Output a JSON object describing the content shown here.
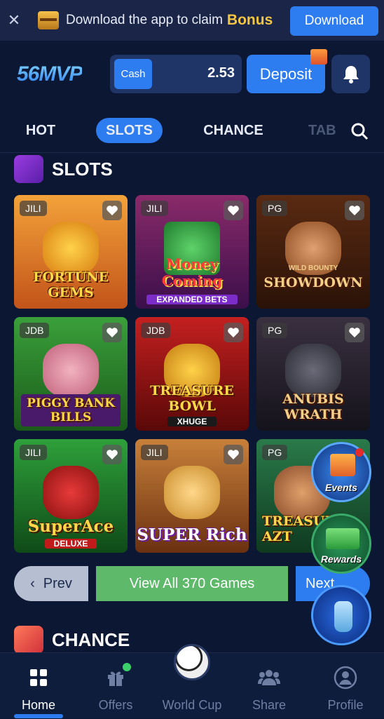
{
  "banner": {
    "message": "Download the app to claim",
    "bonus": "Bonus",
    "download_label": "Download"
  },
  "header": {
    "logo": "56MVP",
    "cash_label": "Cash",
    "balance": "2.53",
    "deposit_label": "Deposit"
  },
  "tabs": [
    {
      "label": "HOT"
    },
    {
      "label": "SLOTS",
      "active": true
    },
    {
      "label": "CHANCE"
    },
    {
      "label": "TAB"
    }
  ],
  "slots_section": {
    "title": "SLOTS",
    "games": [
      {
        "provider": "JILI",
        "title": "FORTUNE GEMS"
      },
      {
        "provider": "JILI",
        "title": "Money Coming",
        "subtitle": "EXPANDED BETS"
      },
      {
        "provider": "PG",
        "title": "SHOWDOWN",
        "subtitle": "WILD BOUNTY"
      },
      {
        "provider": "JDB",
        "title": "PIGGY BANK BILLS"
      },
      {
        "provider": "JDB",
        "title": "TREASURE BOWL",
        "subtitle": "XHUGE"
      },
      {
        "provider": "PG",
        "title": "ANUBIS WRATH"
      },
      {
        "provider": "JILI",
        "title": "SuperAce",
        "subtitle": "DELUXE"
      },
      {
        "provider": "JILI",
        "title": "SUPER Rich"
      },
      {
        "provider": "PG",
        "title": "TREASURE AZT"
      }
    ],
    "prev_label": "Prev",
    "view_all_label": "View All 370 Games",
    "next_label": "Next"
  },
  "chance_section": {
    "title": "CHANCE"
  },
  "floating": {
    "events_label": "Events",
    "rewards_label": "Rewards"
  },
  "bottom_nav": [
    {
      "label": "Home",
      "active": true
    },
    {
      "label": "Offers"
    },
    {
      "label": "World Cup"
    },
    {
      "label": "Share"
    },
    {
      "label": "Profile"
    }
  ],
  "colors": {
    "background": "#0b1733",
    "accent": "#2d7cf0",
    "view_all": "#5fb96a",
    "bonus": "#f4c542"
  }
}
